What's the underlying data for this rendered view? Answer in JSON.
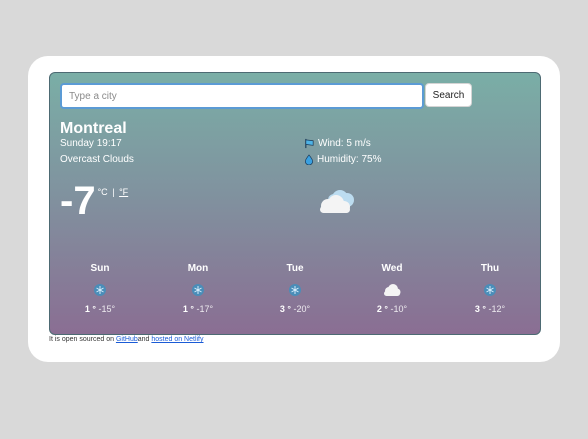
{
  "search": {
    "placeholder": "Type a city",
    "value": "",
    "button_label": "Search"
  },
  "current": {
    "city": "Montreal",
    "datetime": "Sunday 19:17",
    "description": "Overcast Clouds",
    "temperature": "-7",
    "unit_celsius": "°C",
    "unit_separator": "|",
    "unit_fahrenheit": "°F",
    "wind": "Wind: 5 m/s",
    "humidity": "Humidity: 75%",
    "icon": "broken-clouds-icon"
  },
  "forecast": [
    {
      "day": "Sun",
      "max": "1 °",
      "min": "-15°",
      "icon": "snow-icon"
    },
    {
      "day": "Mon",
      "max": "1 °",
      "min": "-17°",
      "icon": "snow-icon"
    },
    {
      "day": "Tue",
      "max": "3 °",
      "min": "-20°",
      "icon": "snow-icon"
    },
    {
      "day": "Wed",
      "max": "2 °",
      "min": "-10°",
      "icon": "cloud-icon"
    },
    {
      "day": "Thu",
      "max": "3 °",
      "min": "-12°",
      "icon": "snow-icon"
    }
  ],
  "footer": {
    "prefix": "It is open sourced on ",
    "github_link": "GitHub",
    "middle": "and ",
    "netlify_link": "hosted on Netlify"
  },
  "colors": {
    "gradient_top": "#7aaea6",
    "gradient_bottom": "#8a6e93",
    "accent": "#5b9bd5",
    "link": "#1a5bd6"
  }
}
